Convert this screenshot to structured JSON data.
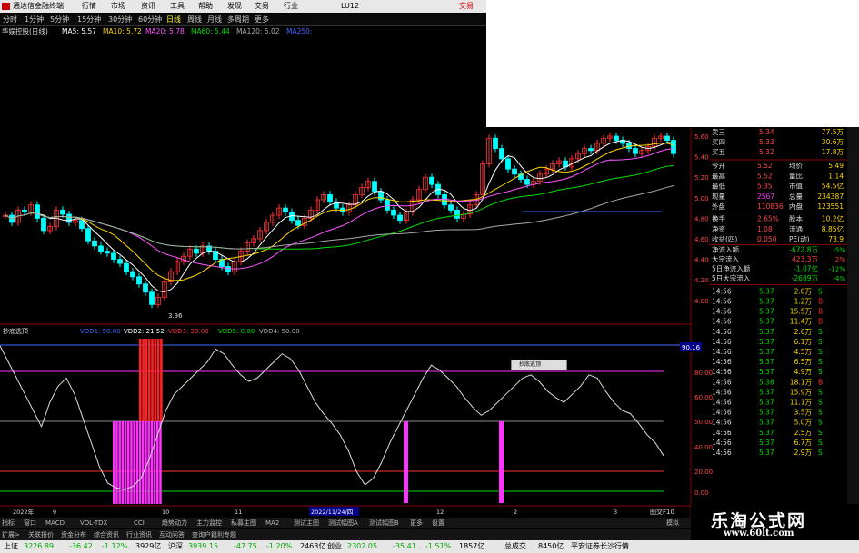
{
  "titlebar": {
    "app_title": "通达信金融终端",
    "menus": [
      "行情",
      "市场",
      "资讯",
      "工具",
      "帮助",
      "发现",
      "交易",
      "行业",
      "LU12"
    ],
    "right_label": "交易"
  },
  "periods": [
    "分时",
    "1分钟",
    "5分钟",
    "15分钟",
    "30分钟",
    "60分钟",
    "日线",
    "周线",
    "月线",
    "多周期",
    "更多"
  ],
  "active_period": "日线",
  "ma_line": {
    "stock": "华娱控股(日线)",
    "items": [
      {
        "label": "MA5: 5.57",
        "color": "#ffffff"
      },
      {
        "label": "MA10: 5.72",
        "color": "#ffd700"
      },
      {
        "label": "MA20: 5.78",
        "color": "#ff55ff"
      },
      {
        "label": "MA60: 5.44",
        "color": "#00dd00"
      },
      {
        "label": "MA120: 5.02",
        "color": "#aaaaaa"
      },
      {
        "label": "MA250:",
        "color": "#4466ff"
      }
    ]
  },
  "price_axis": [
    "5.60",
    "5.40",
    "5.20",
    "5.00",
    "4.80",
    "4.60",
    "4.40",
    "4.20",
    "4.00"
  ],
  "low_marker": "3.96",
  "indicator_line": {
    "name": "抄底逃顶",
    "items": [
      {
        "label": "VDD1: 50.00",
        "color": "#4466ff"
      },
      {
        "label": "VDD2: 21.52",
        "color": "#ffffff"
      },
      {
        "label": "VDD3: 20.00",
        "color": "#ff3333"
      },
      {
        "label": "VDD5: 0.00",
        "color": "#00dd00"
      },
      {
        "label": "VDD4: 50.00",
        "color": "#aaaaaa"
      }
    ]
  },
  "indicator_axis": [
    "90.16",
    "80.00",
    "60.00",
    "50.00",
    "40.00",
    "20.00",
    "0.00"
  ],
  "popup_label": "抄底逃顶",
  "date_axis": [
    "2022年",
    "9",
    "10",
    "11",
    "2022/11/24/四",
    "12",
    "2",
    "3"
  ],
  "quote": {
    "orders": [
      {
        "k": "卖三",
        "p": "5.34",
        "v": "77.5万"
      },
      {
        "k": "买四",
        "p": "5.33",
        "v": "30.6万"
      },
      {
        "k": "买五",
        "p": "5.32",
        "v": "17.8万"
      }
    ],
    "stats": [
      {
        "k1": "今开",
        "v1": "5.52",
        "k2": "均价",
        "v2": "5.49"
      },
      {
        "k1": "最高",
        "v1": "5.52",
        "k2": "量比",
        "v2": "1.14"
      },
      {
        "k1": "最低",
        "v1": "5.35",
        "k2": "市值",
        "v2": "54.5亿"
      },
      {
        "k1": "现量",
        "v1": "2567",
        "k2": "总量",
        "v2": "234387"
      },
      {
        "k1": "外盘",
        "v1": "110836",
        "k2": "内盘",
        "v2": "123551"
      },
      {
        "k1": "换手",
        "v1": "2.65%",
        "k2": "股本",
        "v2": "10.2亿"
      },
      {
        "k1": "净资",
        "v1": "1.08",
        "k2": "流通",
        "v2": "8.85亿"
      },
      {
        "k1": "收益(四)",
        "v1": "0.050",
        "k2": "PE(动)",
        "v2": "73.9"
      }
    ],
    "flows": [
      {
        "k": "净流入额",
        "v": "-672.8万",
        "p": "-5%"
      },
      {
        "k": "大宗流入",
        "v": "423.3万",
        "p": "2%"
      },
      {
        "k": "5日净流入额",
        "v": "-1.07亿",
        "p": "-12%"
      },
      {
        "k": "5日大宗流入",
        "v": "-2689万",
        "p": "-4%"
      }
    ],
    "ticks": [
      {
        "t": "14:56",
        "p": "5.37",
        "v": "2.0万",
        "s": "S"
      },
      {
        "t": "14:56",
        "p": "5.37",
        "v": "1.2万",
        "s": "B"
      },
      {
        "t": "14:56",
        "p": "5.37",
        "v": "15.5万",
        "s": "B"
      },
      {
        "t": "14:56",
        "p": "5.37",
        "v": "11.4万",
        "s": "B"
      },
      {
        "t": "14:56",
        "p": "5.37",
        "v": "2.6万",
        "s": "S"
      },
      {
        "t": "14:56",
        "p": "5.37",
        "v": "6.1万",
        "s": "S"
      },
      {
        "t": "14:56",
        "p": "5.37",
        "v": "4.5万",
        "s": "S"
      },
      {
        "t": "14:56",
        "p": "5.37",
        "v": "6.5万",
        "s": "S"
      },
      {
        "t": "14:56",
        "p": "5.37",
        "v": "4.9万",
        "s": "S"
      },
      {
        "t": "14:56",
        "p": "5.38",
        "v": "18.1万",
        "s": "B"
      },
      {
        "t": "14:56",
        "p": "5.37",
        "v": "15.9万",
        "s": "S"
      },
      {
        "t": "14:56",
        "p": "5.37",
        "v": "11.1万",
        "s": "S"
      },
      {
        "t": "14:56",
        "p": "5.37",
        "v": "3.5万",
        "s": "S"
      },
      {
        "t": "14:56",
        "p": "5.37",
        "v": "5.0万",
        "s": "S"
      },
      {
        "t": "14:56",
        "p": "5.37",
        "v": "2.5万",
        "s": "S"
      },
      {
        "t": "14:56",
        "p": "5.37",
        "v": "6.7万",
        "s": "S"
      },
      {
        "t": "14:56",
        "p": "5.37",
        "v": "2.9万",
        "s": "S"
      }
    ]
  },
  "indicator_tabs": [
    "指标",
    "窗口",
    "MACD",
    "VOL-TDX",
    "CCI",
    "趋势动力",
    "主力监控",
    "私募主图",
    "MA2",
    "测试主图",
    "测试幅图A",
    "测试幅图B",
    "更多",
    "设置"
  ],
  "info_tabs": [
    "扩展>",
    "关联报价",
    "资金分布",
    "综合资讯",
    "行业资讯",
    "互动问答",
    "查询户籍利专题"
  ],
  "index_bar": [
    {
      "name": "上证",
      "val": "3226.89",
      "chg": "-36.42",
      "pct": "-1.12%",
      "amt": "3929亿"
    },
    {
      "name": "沪深",
      "val": "3939.15",
      "chg": "-47.75",
      "pct": "-1.20%",
      "amt": "2463亿"
    },
    {
      "name": "创业",
      "val": "2302.05",
      "chg": "-35.41",
      "pct": "-1.51%",
      "amt": "1857亿"
    }
  ],
  "total_label": "总成交",
  "total_value": "8450亿",
  "broker_label": "平安证券长沙行情",
  "right_small_label": "图交F10",
  "tab_right": "模拟",
  "watermark": {
    "title": "乐淘公式网",
    "url": "www.60lt.com"
  },
  "colors": {
    "up": "#ff3333",
    "down": "#00ffff",
    "magenta": "#ff33ff",
    "green": "#00dd00"
  }
}
